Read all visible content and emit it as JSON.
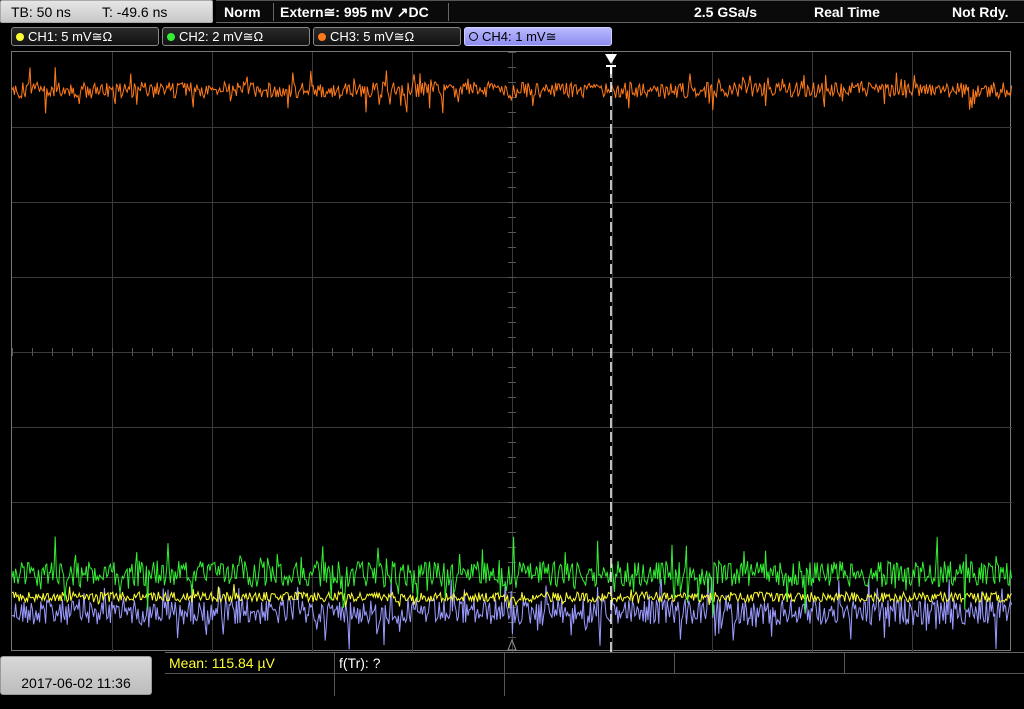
{
  "topbar": {
    "timebase": "TB: 50 ns",
    "trigger_offset": "T: -49.6 ns",
    "mode": "Norm",
    "trigger": "Extern≅: 995 mV ↗DC",
    "sample_rate": "2.5 GSa/s",
    "acquisition": "Real Time",
    "status": "Not Rdy."
  },
  "channels": [
    {
      "label": "CH1: 5 mV≅Ω",
      "color": "#ffff33",
      "active": false
    },
    {
      "label": "CH2: 2 mV≅Ω",
      "color": "#33ee33",
      "active": false
    },
    {
      "label": "CH3: 5 mV≅Ω",
      "color": "#ff7a1a",
      "active": false
    },
    {
      "label": "CH4: 1 mV≅",
      "color": "#9b9bff",
      "active": true
    }
  ],
  "bottom": {
    "datetime": "2017-06-02 11:36",
    "mean": "Mean: 115.84 µV",
    "freq": "f(Tr): ?"
  },
  "colors": {
    "grid": "#3a3a3a",
    "trigger_line": "#ffffff"
  }
}
